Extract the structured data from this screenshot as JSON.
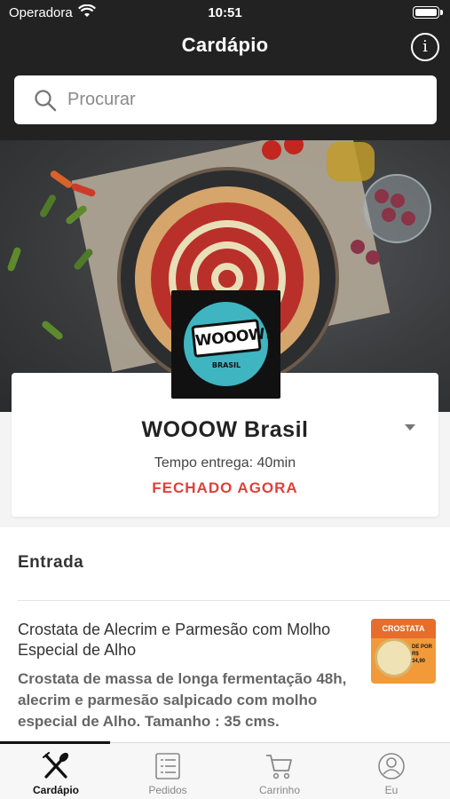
{
  "status_bar": {
    "carrier": "Operadora",
    "time": "10:51"
  },
  "header": {
    "title": "Cardápio",
    "info_icon": "info-icon",
    "info_glyph": "i"
  },
  "search": {
    "placeholder": "Procurar",
    "value": ""
  },
  "restaurant": {
    "logo_text": "WOOOW!",
    "logo_sub": "BRASIL",
    "name": "WOOOW Brasil",
    "delivery_time": "Tempo entrega: 40min",
    "status": "FECHADO AGORA"
  },
  "menu": {
    "section_title": "Entrada",
    "items": [
      {
        "title": "Crostata de Alecrim e Parmesão com Molho Especial de Alho",
        "description": "Crostata de massa de longa fermentação 48h, alecrim e parmesão salpicado com molho especial de Alho. Tamanho : 35 cms.",
        "thumb_heading": "CROSTATA",
        "thumb_price": "DE POR R$ 34,90"
      }
    ]
  },
  "tabs": [
    {
      "label": "Cardápio",
      "icon": "fork-knife-icon",
      "active": true
    },
    {
      "label": "Pedidos",
      "icon": "list-icon",
      "active": false
    },
    {
      "label": "Carrinho",
      "icon": "cart-icon",
      "active": false
    },
    {
      "label": "Eu",
      "icon": "user-icon",
      "active": false
    }
  ],
  "colors": {
    "header_bg": "#222222",
    "closed_red": "#e0403b",
    "logo_teal": "#3fb5c1"
  }
}
